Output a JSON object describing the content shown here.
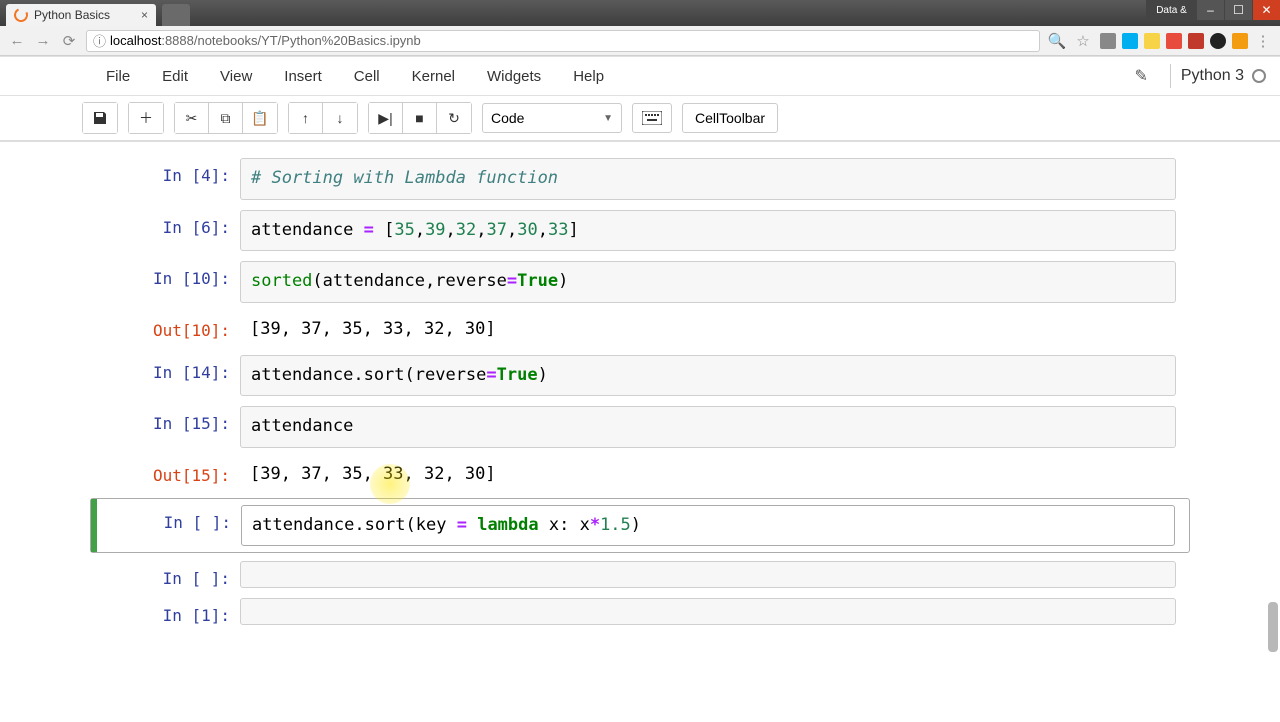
{
  "browser": {
    "tab_title": "Python Basics",
    "url_host": "localhost",
    "url_port_path": ":8888/notebooks/YT/Python%20Basics.ipynb",
    "win_data_label": "Data &"
  },
  "menubar": {
    "items": [
      "File",
      "Edit",
      "View",
      "Insert",
      "Cell",
      "Kernel",
      "Widgets",
      "Help"
    ],
    "kernel": "Python 3"
  },
  "toolbar": {
    "cell_type": "Code",
    "celltoolbar_label": "CellToolbar"
  },
  "cells": [
    {
      "kind": "in",
      "n": "4",
      "code_html": "<span class='c-comment'># Sorting with Lambda function</span>"
    },
    {
      "kind": "in",
      "n": "6",
      "code_html": "attendance <span class='c-op'>=</span> [<span class='c-num'>35</span>,<span class='c-num'>39</span>,<span class='c-num'>32</span>,<span class='c-num'>37</span>,<span class='c-num'>30</span>,<span class='c-num'>33</span>]"
    },
    {
      "kind": "in",
      "n": "10",
      "code_html": "<span class='c-builtin'>sorted</span>(attendance,reverse<span class='c-op'>=</span><span class='c-kw'>True</span>)"
    },
    {
      "kind": "out",
      "n": "10",
      "text": "[39, 37, 35, 33, 32, 30]"
    },
    {
      "kind": "in",
      "n": "14",
      "code_html": "attendance.sort(reverse<span class='c-op'>=</span><span class='c-kw'>True</span>)"
    },
    {
      "kind": "in",
      "n": "15",
      "code_html": "attendance"
    },
    {
      "kind": "out",
      "n": "15",
      "text": "[39, 37, 35, 33, 32, 30]"
    },
    {
      "kind": "in",
      "n": " ",
      "selected": true,
      "code_html": "attendance.sort(key <span class='c-op'>=</span> <span class='c-keyword'>lambda</span> x: x<span class='c-op'>*</span><span class='c-num'>1.5</span>)"
    },
    {
      "kind": "in",
      "n": " ",
      "code_html": ""
    },
    {
      "kind": "in",
      "n": "1",
      "code_html": ""
    }
  ]
}
